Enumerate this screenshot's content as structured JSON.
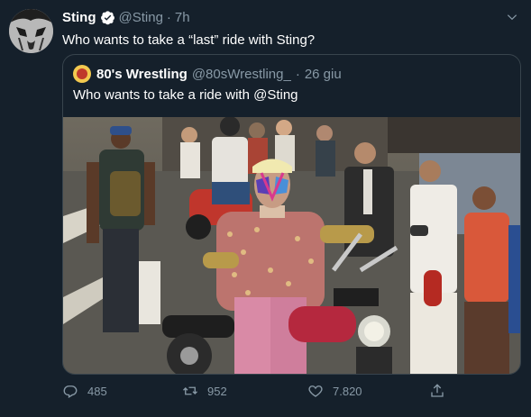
{
  "tweet": {
    "name": "Sting",
    "handle": "@Sting",
    "separator": "·",
    "time": "7h",
    "text": "Who wants to take a “last” ride with Sting?"
  },
  "quoted": {
    "name": "80's Wrestling",
    "handle": "@80sWrestling_",
    "separator": "·",
    "date": "26 giu",
    "text": "Who wants to take a ride with @Sting"
  },
  "actions": {
    "replies": "485",
    "retweets": "952",
    "likes": "7.820"
  },
  "colors": {
    "background": "#15202b",
    "secondary_text": "#8899a6",
    "verified": "#ffffff"
  },
  "icons": [
    "reply-icon",
    "retweet-icon",
    "like-icon",
    "share-icon",
    "verified-icon",
    "chevron-down-icon"
  ]
}
